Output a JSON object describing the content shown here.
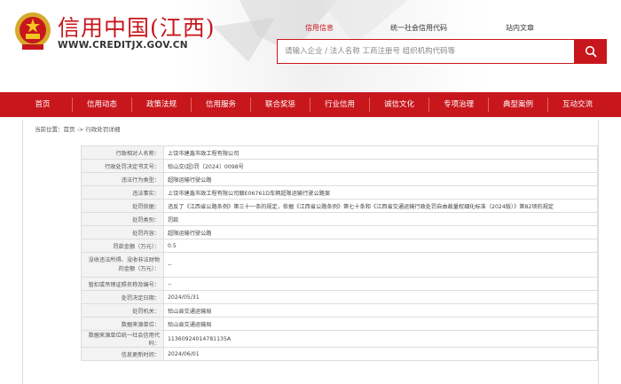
{
  "site": {
    "title": "信用中国(江西)",
    "url": "WWW.CREDITJX.GOV.CN"
  },
  "top_links": [
    {
      "label": "信用信息",
      "active": true
    },
    {
      "label": "统一社会信用代码",
      "active": false
    },
    {
      "label": "站内文章",
      "active": false
    }
  ],
  "search": {
    "placeholder": "请输入企业 / 法人名称 工商注册号 组织机构代码等",
    "button_icon": "search-icon"
  },
  "nav": [
    "首页",
    "信用动态",
    "政策法规",
    "信用服务",
    "联合奖惩",
    "行业信用",
    "诚信文化",
    "专项治理",
    "典型案例",
    "互动交流"
  ],
  "breadcrumb": "当前位置：首页 -> 行政处罚详细",
  "details": [
    {
      "label": "行政相对人名称：",
      "value": "上饶市建鑫市政工程有限公司"
    },
    {
      "label": "行政处罚决定书文号：",
      "value": "铅山交(超)罚〔2024〕0098号"
    },
    {
      "label": "违法行为类型：",
      "value": "超限运输行驶公路"
    },
    {
      "label": "违法事实：",
      "value": "上饶市建鑫市政工程有限公司赣E06761D车辆超限运输行驶公路案"
    },
    {
      "label": "处罚依据：",
      "value": "违反了《江西省公路条例》第三十一条的规定，依据《江西省公路条例》第七十条和《江西省交通运输行政处罚自由裁量权细化标准（2024版）》第82项的规定"
    },
    {
      "label": "处罚类别：",
      "value": "罚款"
    },
    {
      "label": "处罚内容：",
      "value": "超限运输行驶公路"
    },
    {
      "label": "罚款金额（万元）：",
      "value": "0.5"
    },
    {
      "label": "没收违法所得、没收非法财物的金额（万元）：",
      "value": "--"
    },
    {
      "label": "暂扣或吊销证照名称及编号：",
      "value": "--"
    },
    {
      "label": "处罚决定日期：",
      "value": "2024/05/31"
    },
    {
      "label": "处罚机关：",
      "value": "铅山县交通运输局"
    },
    {
      "label": "数据来源单位：",
      "value": "铅山县交通运输局"
    },
    {
      "label": "数据来源单位统一社会信用代码：",
      "value": "11360924014781135A"
    },
    {
      "label": "信息更新时间：",
      "value": "2024/06/01"
    }
  ],
  "colors": {
    "brand": "#c8161d",
    "label_bg": "#f3f3f3",
    "border": "#dddddd"
  }
}
